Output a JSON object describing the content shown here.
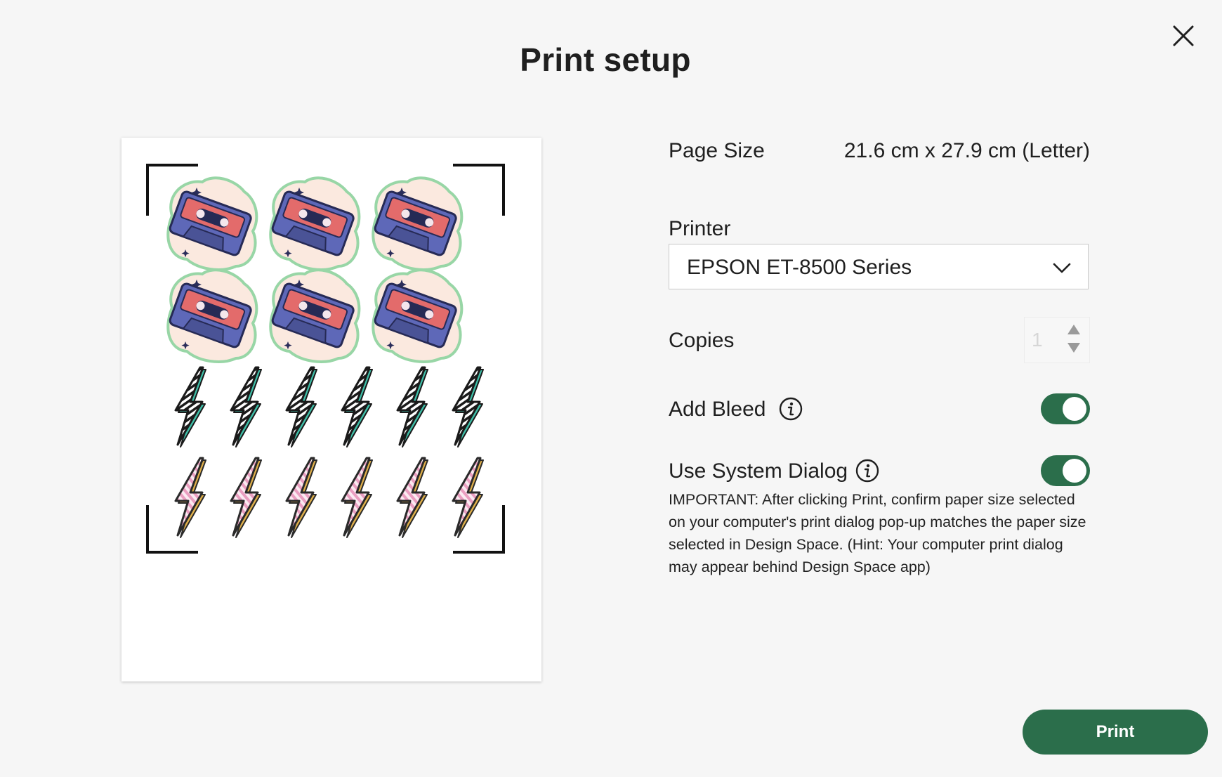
{
  "dialog": {
    "title": "Print setup"
  },
  "settings": {
    "page_size_label": "Page Size",
    "page_size_value": "21.6 cm x 27.9 cm (Letter)",
    "printer_label": "Printer",
    "printer_value": "EPSON ET-8500 Series",
    "copies_label": "Copies",
    "copies_value": "1",
    "add_bleed_label": "Add Bleed",
    "add_bleed_on": true,
    "system_dialog_label": "Use System Dialog",
    "system_dialog_on": true,
    "system_dialog_note": "IMPORTANT: After clicking Print, confirm paper size selected on your computer's print dialog pop-up matches the paper size selected in Design Space. (Hint: Your computer print dialog may appear behind Design Space app)"
  },
  "actions": {
    "print_label": "Print"
  },
  "icons": [
    "close-icon",
    "chevron-down-icon",
    "info-icon",
    "cassette-sticker",
    "lightning-bolt-sticker"
  ],
  "colors": {
    "accent": "#2b6e4b",
    "background": "#f6f6f6"
  }
}
